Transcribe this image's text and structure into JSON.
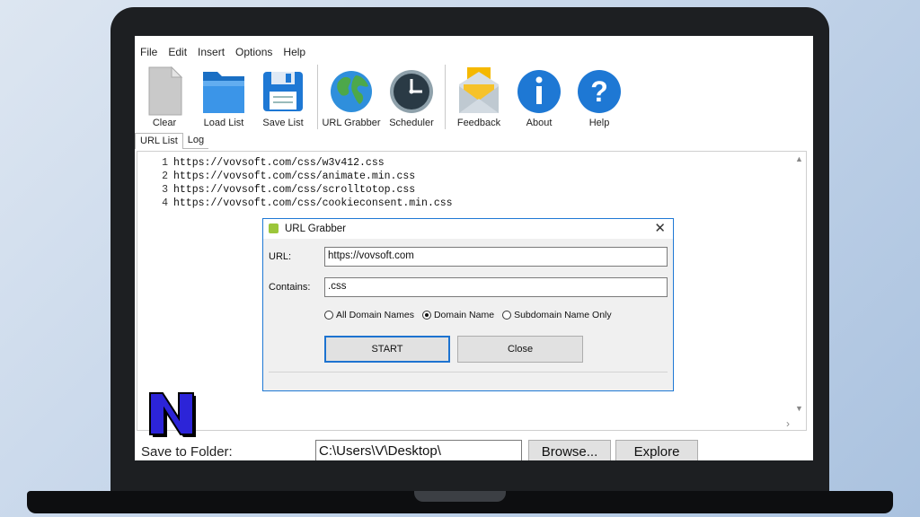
{
  "menu": [
    "File",
    "Edit",
    "Insert",
    "Options",
    "Help"
  ],
  "toolbar": {
    "clear": "Clear",
    "load_list": "Load List",
    "save_list": "Save List",
    "url_grabber": "URL Grabber",
    "scheduler": "Scheduler",
    "feedback": "Feedback",
    "about": "About",
    "help": "Help"
  },
  "tabs": [
    "URL List",
    "Log"
  ],
  "url_list": [
    {
      "n": "1",
      "url": "https://vovsoft.com/css/w3v412.css"
    },
    {
      "n": "2",
      "url": "https://vovsoft.com/css/animate.min.css"
    },
    {
      "n": "3",
      "url": "https://vovsoft.com/css/scrolltotop.css"
    },
    {
      "n": "4",
      "url": "https://vovsoft.com/css/cookieconsent.min.css"
    }
  ],
  "dialog": {
    "title": "URL Grabber",
    "url_label": "URL:",
    "url_value": "https://vovsoft.com",
    "contains_label": "Contains:",
    "contains_value": ".css",
    "radio_all": "All Domain Names",
    "radio_domain": "Domain Name",
    "radio_sub": "Subdomain Name Only",
    "selected": "Domain Name",
    "start": "START",
    "close": "Close"
  },
  "bottom": {
    "save_label": "Save to Folder:",
    "folder": "C:\\Users\\V\\Desktop\\",
    "browse": "Browse...",
    "explore": "Explore"
  },
  "colors": {
    "accent": "#1e78d4",
    "logo_fill": "#2c24d8"
  }
}
